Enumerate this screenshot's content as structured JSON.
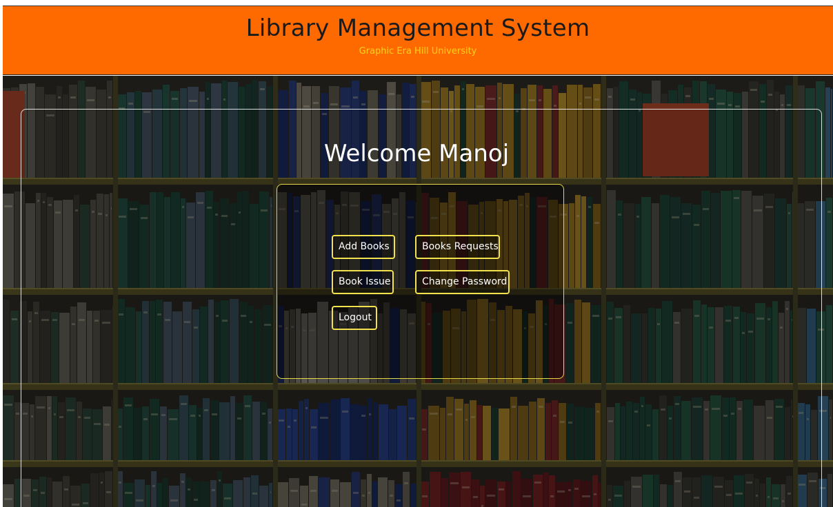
{
  "header": {
    "title": "Library Management System",
    "subtitle": "Graphic Era Hill University"
  },
  "main": {
    "welcome": "Welcome Manoj"
  },
  "menu": {
    "add_books": "Add Books",
    "books_requests": "Books Requests",
    "book_issue": "Book Issue",
    "change_password": "Change Password",
    "logout": "Logout"
  },
  "colors": {
    "header_bg": "#ff6a00",
    "subtitle": "#ffd21a",
    "button_border": "#f2e24d",
    "panel_border": "#ffffff"
  }
}
